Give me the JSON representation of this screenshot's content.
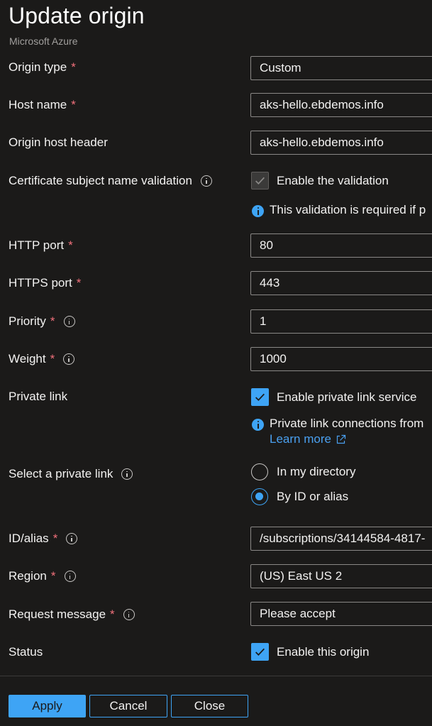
{
  "header": {
    "title": "Update origin",
    "subtitle": "Microsoft Azure"
  },
  "fields": {
    "origin_type": {
      "label": "Origin type",
      "required": "*",
      "value": "Custom"
    },
    "host_name": {
      "label": "Host name",
      "required": "*",
      "value": "aks-hello.ebdemos.info"
    },
    "origin_host_header": {
      "label": "Origin host header",
      "value": "aks-hello.ebdemos.info"
    },
    "cert_validation": {
      "label": "Certificate subject name validation",
      "checkbox_label": "Enable the validation",
      "checked": true,
      "disabled": true,
      "note": "This validation is required if p"
    },
    "http_port": {
      "label": "HTTP port",
      "required": "*",
      "value": "80"
    },
    "https_port": {
      "label": "HTTPS port",
      "required": "*",
      "value": "443"
    },
    "priority": {
      "label": "Priority",
      "required": "*",
      "value": "1"
    },
    "weight": {
      "label": "Weight",
      "required": "*",
      "value": "1000"
    },
    "private_link": {
      "label": "Private link",
      "checkbox_label": "Enable private link service",
      "checked": true,
      "note": "Private link connections from",
      "learn_more": "Learn more"
    },
    "select_private_link": {
      "label": "Select a private link",
      "options": [
        "In my directory",
        "By ID or alias"
      ],
      "selected": "By ID or alias"
    },
    "id_alias": {
      "label": "ID/alias",
      "required": "*",
      "value": "/subscriptions/34144584-4817-"
    },
    "region": {
      "label": "Region",
      "required": "*",
      "value": "(US) East US 2"
    },
    "request_message": {
      "label": "Request message",
      "required": "*",
      "value": "Please accept"
    },
    "status": {
      "label": "Status",
      "checkbox_label": "Enable this origin",
      "checked": true
    }
  },
  "footer": {
    "apply_label": "Apply",
    "cancel_label": "Cancel",
    "close_label": "Close"
  },
  "colors": {
    "background": "#1b1a19",
    "accent": "#3ea4f5",
    "required": "#f1707b",
    "link": "#4aa0f0"
  }
}
